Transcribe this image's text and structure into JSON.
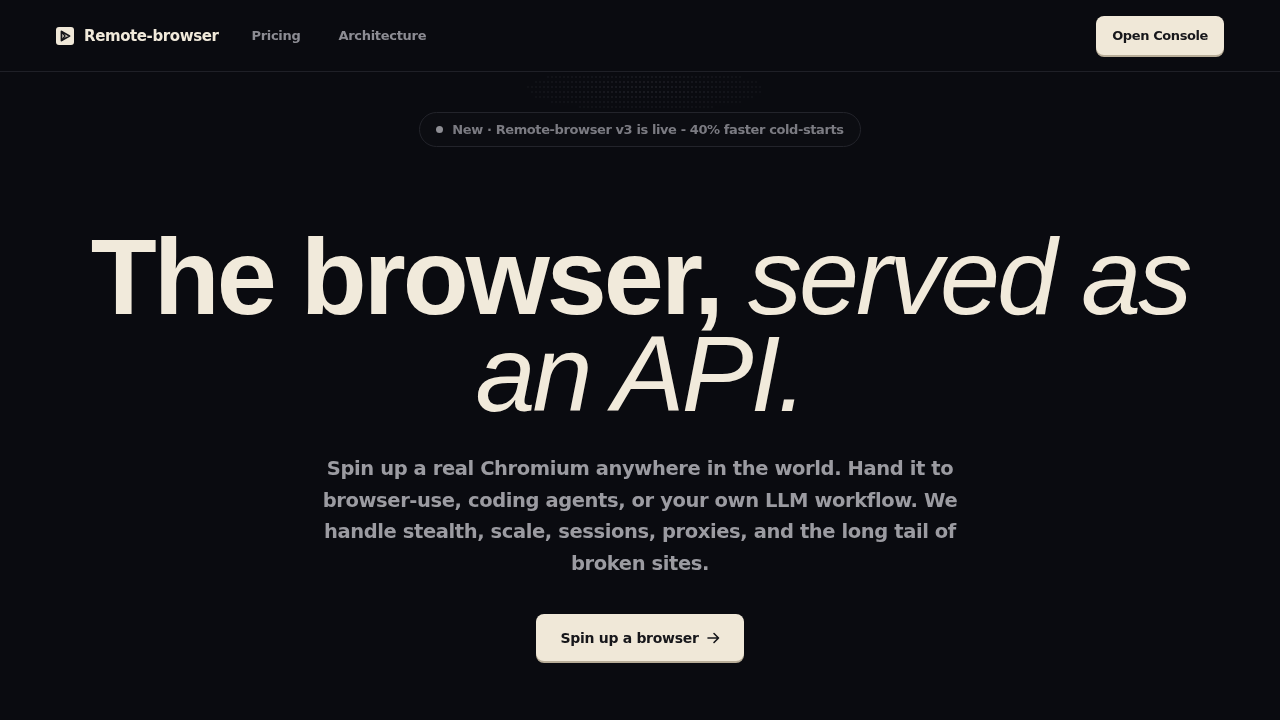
{
  "nav": {
    "brand": "Remote-browser",
    "links": [
      {
        "label": "Pricing"
      },
      {
        "label": "Architecture"
      }
    ],
    "cta": "Open Console"
  },
  "hero": {
    "announcement": "New · Remote-browser v3 is live - 40% faster cold-starts",
    "headline": "**The browser,** *served as an API.*",
    "description": "Spin up a real Chromium anywhere in the world. Hand it to browser-use, coding agents, or your own LLM workflow. We handle stealth, scale, sessions, proxies, and the long tail of broken sites.",
    "cta": "Spin up a browser"
  }
}
